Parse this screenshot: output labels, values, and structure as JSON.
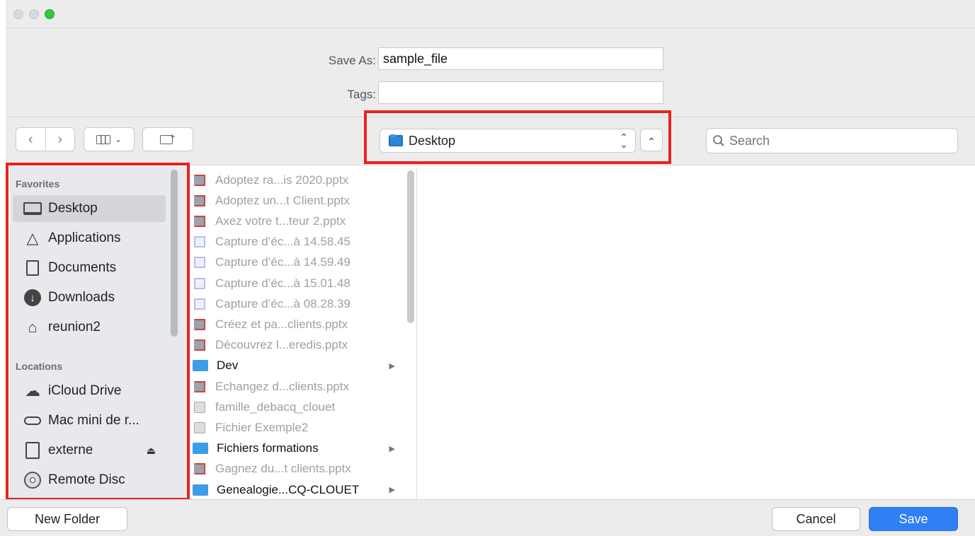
{
  "form": {
    "save_as_label": "Save As:",
    "save_as_value": "sample_file",
    "tags_label": "Tags:",
    "tags_value": ""
  },
  "toolbar": {
    "location": "Desktop",
    "search_placeholder": "Search"
  },
  "sidebar": {
    "favorites_header": "Favorites",
    "favorites": [
      {
        "label": "Desktop",
        "icon": "desktop-icon",
        "selected": true
      },
      {
        "label": "Applications",
        "icon": "applications-icon"
      },
      {
        "label": "Documents",
        "icon": "documents-icon"
      },
      {
        "label": "Downloads",
        "icon": "downloads-icon"
      },
      {
        "label": "reunion2",
        "icon": "home-icon"
      }
    ],
    "locations_header": "Locations",
    "locations": [
      {
        "label": "iCloud Drive",
        "icon": "cloud-icon"
      },
      {
        "label": "Mac mini de r...",
        "icon": "computer-icon"
      },
      {
        "label": "externe",
        "icon": "disk-icon"
      },
      {
        "label": "Remote Disc",
        "icon": "disc-icon"
      }
    ]
  },
  "files": [
    {
      "name": "Adoptez ra...is 2020.pptx",
      "kind": "pptx",
      "folder": false
    },
    {
      "name": "Adoptez un...t Client.pptx",
      "kind": "pptx",
      "folder": false
    },
    {
      "name": "Axez votre t...teur 2.pptx",
      "kind": "pptx",
      "folder": false
    },
    {
      "name": "Capture d’éc...à 14.58.45",
      "kind": "png",
      "folder": false
    },
    {
      "name": "Capture d’éc...à 14.59.49",
      "kind": "png",
      "folder": false
    },
    {
      "name": "Capture d’éc...à 15.01.48",
      "kind": "png",
      "folder": false
    },
    {
      "name": "Capture d’éc...à 08.28.39",
      "kind": "png",
      "folder": false
    },
    {
      "name": "Créez et pa...clients.pptx",
      "kind": "pptx",
      "folder": false
    },
    {
      "name": "Découvrez l...eredis.pptx",
      "kind": "pptx",
      "folder": false
    },
    {
      "name": "Dev",
      "kind": "folder",
      "folder": true
    },
    {
      "name": "Echangez d...clients.pptx",
      "kind": "pptx",
      "folder": false
    },
    {
      "name": "famille_debacq_clouet",
      "kind": "doc",
      "folder": false
    },
    {
      "name": "Fichier Exemple2",
      "kind": "doc",
      "folder": false
    },
    {
      "name": "Fichiers formations",
      "kind": "folder",
      "folder": true
    },
    {
      "name": "Gagnez du...t clients.pptx",
      "kind": "pptx",
      "folder": false
    },
    {
      "name": "Genealogie...CQ-CLOUET",
      "kind": "folder",
      "folder": true
    }
  ],
  "buttons": {
    "new_folder": "New Folder",
    "cancel": "Cancel",
    "save": "Save"
  },
  "colors": {
    "highlight": "#e8231f",
    "primary": "#2f7ff5",
    "folder": "#3d9de8"
  }
}
